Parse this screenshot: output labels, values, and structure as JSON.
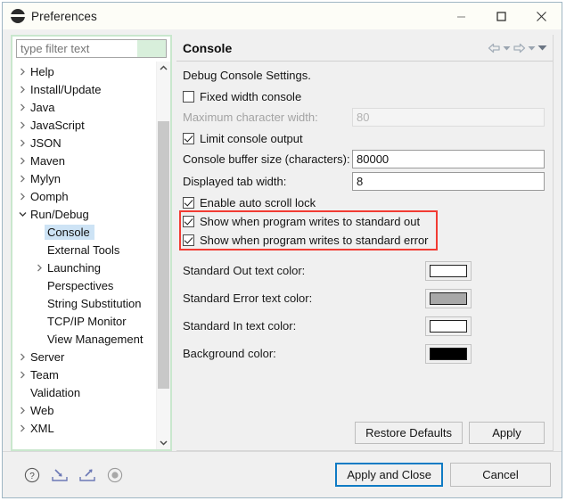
{
  "window": {
    "title": "Preferences",
    "icon": "eclipse-icon",
    "controls": {
      "minimize": "minimize-icon",
      "maximize": "maximize-icon",
      "close": "close-icon"
    }
  },
  "sidebar": {
    "filter": {
      "placeholder": "type filter text",
      "value": ""
    },
    "items": [
      {
        "label": "Help",
        "level": 1,
        "arrow": "collapsed",
        "selected": false
      },
      {
        "label": "Install/Update",
        "level": 1,
        "arrow": "collapsed",
        "selected": false
      },
      {
        "label": "Java",
        "level": 1,
        "arrow": "collapsed",
        "selected": false
      },
      {
        "label": "JavaScript",
        "level": 1,
        "arrow": "collapsed",
        "selected": false
      },
      {
        "label": "JSON",
        "level": 1,
        "arrow": "collapsed",
        "selected": false
      },
      {
        "label": "Maven",
        "level": 1,
        "arrow": "collapsed",
        "selected": false
      },
      {
        "label": "Mylyn",
        "level": 1,
        "arrow": "collapsed",
        "selected": false
      },
      {
        "label": "Oomph",
        "level": 1,
        "arrow": "collapsed",
        "selected": false
      },
      {
        "label": "Run/Debug",
        "level": 1,
        "arrow": "expanded",
        "selected": false
      },
      {
        "label": "Console",
        "level": 2,
        "arrow": "none",
        "selected": true
      },
      {
        "label": "External Tools",
        "level": 2,
        "arrow": "none",
        "selected": false
      },
      {
        "label": "Launching",
        "level": 2,
        "arrow": "collapsed",
        "selected": false
      },
      {
        "label": "Perspectives",
        "level": 2,
        "arrow": "none",
        "selected": false
      },
      {
        "label": "String Substitution",
        "level": 2,
        "arrow": "none",
        "selected": false
      },
      {
        "label": "TCP/IP Monitor",
        "level": 2,
        "arrow": "none",
        "selected": false
      },
      {
        "label": "View Management",
        "level": 2,
        "arrow": "none",
        "selected": false
      },
      {
        "label": "Server",
        "level": 1,
        "arrow": "collapsed",
        "selected": false
      },
      {
        "label": "Team",
        "level": 1,
        "arrow": "collapsed",
        "selected": false
      },
      {
        "label": "Validation",
        "level": 1,
        "arrow": "none",
        "selected": false
      },
      {
        "label": "Web",
        "level": 1,
        "arrow": "collapsed",
        "selected": false
      },
      {
        "label": "XML",
        "level": 1,
        "arrow": "collapsed",
        "selected": false
      }
    ]
  },
  "page": {
    "title": "Console",
    "description": "Debug Console Settings.",
    "nav": [
      "back-arrow-icon",
      "back-dropdown-icon",
      "forward-arrow-icon",
      "forward-dropdown-icon",
      "menu-dropdown-icon"
    ],
    "fixed_width_console": {
      "label": "Fixed width console",
      "checked": false
    },
    "maximum_character_width": {
      "label": "Maximum character width:",
      "value": "80",
      "disabled": true
    },
    "limit_console_output": {
      "label": "Limit console output",
      "checked": true
    },
    "console_buffer_size": {
      "label": "Console buffer size (characters):",
      "value": "80000"
    },
    "displayed_tab_width": {
      "label": "Displayed tab width:",
      "value": "8"
    },
    "enable_auto_scroll_lock": {
      "label": "Enable auto scroll lock",
      "checked": true
    },
    "show_standard_out": {
      "label": "Show when program writes to standard out",
      "checked": true
    },
    "show_standard_error": {
      "label": "Show when program writes to standard error",
      "checked": true
    },
    "highlight_color": "#f23b33",
    "colors": [
      {
        "label": "Standard Out text color:",
        "value": "#ffffff"
      },
      {
        "label": "Standard Error text color:",
        "value": "#a8a8a8"
      },
      {
        "label": "Standard In text color:",
        "value": "#ffffff"
      },
      {
        "label": "Background color:",
        "value": "#000000"
      }
    ],
    "restore_defaults": "Restore Defaults",
    "apply": "Apply"
  },
  "footer": {
    "icons": [
      "help-icon",
      "import-icon",
      "export-icon",
      "record-icon"
    ],
    "apply_and_close": "Apply and Close",
    "cancel": "Cancel",
    "focus_color": "#0f7bc4"
  }
}
